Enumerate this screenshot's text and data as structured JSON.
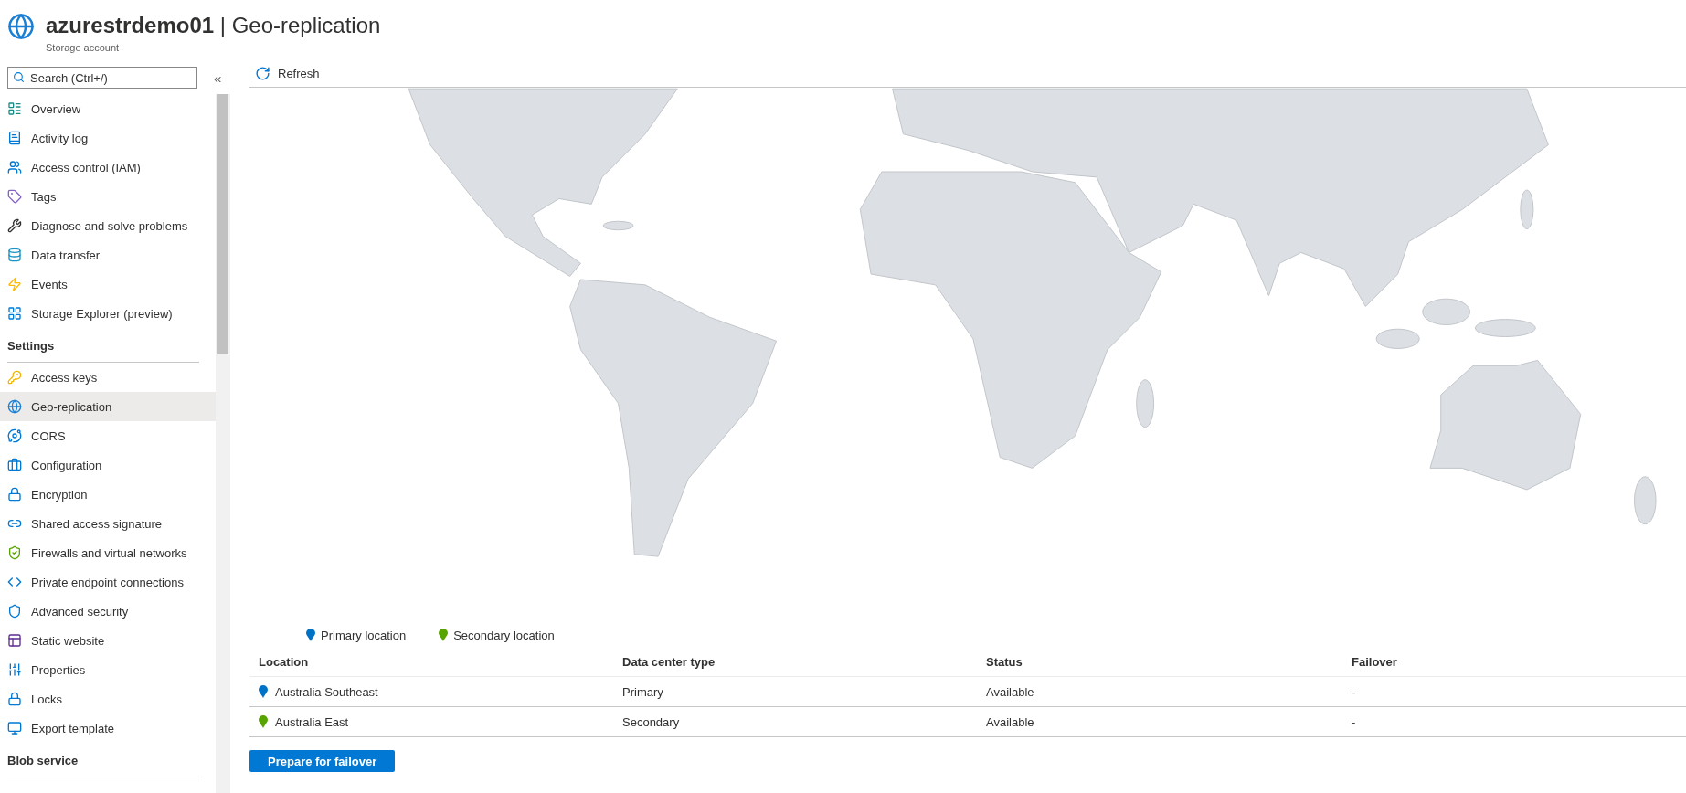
{
  "header": {
    "title": "**azurestrdemo01** | Geo-replication",
    "subtitle": "Storage account"
  },
  "sidebar": {
    "search": {
      "placeholder": "Search (Ctrl+/)"
    },
    "collapse": "«",
    "sections": [
      {
        "items": [
          {
            "label": "Overview",
            "selected": false
          },
          {
            "label": "Activity log",
            "selected": false
          },
          {
            "label": "Access control (IAM)",
            "selected": false
          },
          {
            "label": "Tags",
            "selected": false
          },
          {
            "label": "Diagnose and solve problems",
            "selected": false
          },
          {
            "label": "Data transfer",
            "selected": false
          },
          {
            "label": "Events",
            "selected": false
          },
          {
            "label": "Storage Explorer (preview)",
            "selected": false
          }
        ]
      },
      {
        "heading": "Settings",
        "items": [
          {
            "label": "Access keys",
            "selected": false
          },
          {
            "label": "Geo-replication",
            "selected": true
          },
          {
            "label": "CORS",
            "selected": false
          },
          {
            "label": "Configuration",
            "selected": false
          },
          {
            "label": "Encryption",
            "selected": false
          },
          {
            "label": "Shared access signature",
            "selected": false
          },
          {
            "label": "Firewalls and virtual networks",
            "selected": false
          },
          {
            "label": "Private endpoint connections",
            "selected": false
          },
          {
            "label": "Advanced security",
            "selected": false
          },
          {
            "label": "Static website",
            "selected": false
          },
          {
            "label": "Properties",
            "selected": false
          },
          {
            "label": "Locks",
            "selected": false
          },
          {
            "label": "Export template",
            "selected": false
          }
        ]
      },
      {
        "heading": "Blob service"
      }
    ]
  },
  "toolbar": {
    "refresh": "Refresh"
  },
  "legend": [
    {
      "label": "Primary location",
      "color": "#0072c6"
    },
    {
      "label": "Secondary location",
      "color": "#57a300"
    }
  ],
  "table": {
    "columns": [
      "Location",
      "Data center type",
      "Status",
      "Failover"
    ],
    "rows": [
      {
        "location": "Australia Southeast",
        "color": "#0072c6",
        "type": "Primary",
        "status": "Available",
        "failover": "-"
      },
      {
        "location": "Australia East",
        "color": "#57a300",
        "type": "Secondary",
        "status": "Available",
        "failover": "-"
      }
    ]
  },
  "button": "Prepare for failover"
}
